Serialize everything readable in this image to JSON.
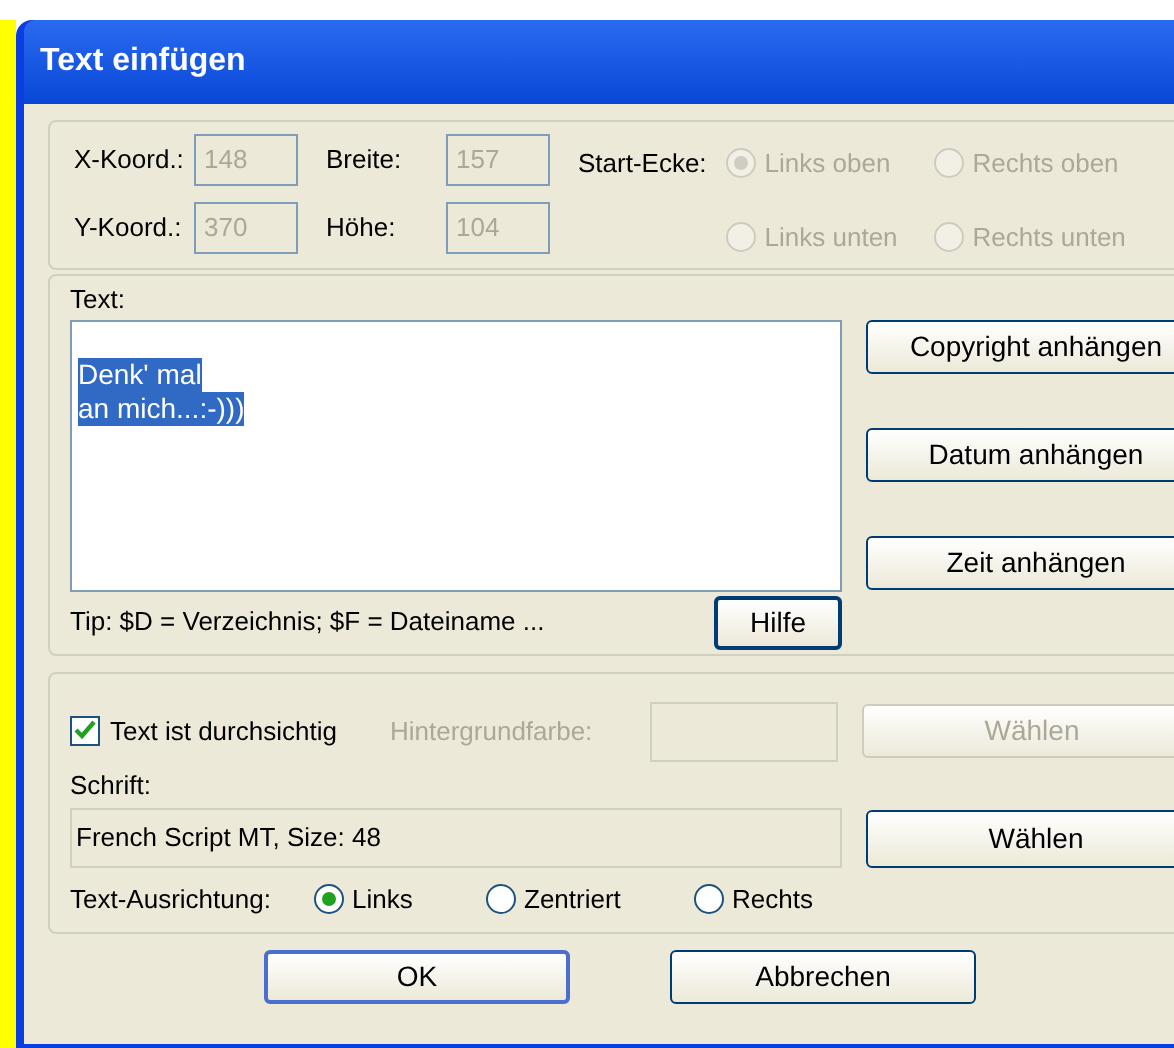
{
  "window": {
    "title": "Text einfügen"
  },
  "position": {
    "x": {
      "label": "X-Koord.:",
      "value": "148",
      "disabled": true
    },
    "y": {
      "label": "Y-Koord.:",
      "value": "370",
      "disabled": true
    },
    "width": {
      "label": "Breite:",
      "value": "157",
      "disabled": true
    },
    "height": {
      "label": "Höhe:",
      "value": "104",
      "disabled": true
    }
  },
  "start_corner": {
    "label": "Start-Ecke:",
    "options": [
      {
        "label": "Links oben",
        "selected": true,
        "disabled": true
      },
      {
        "label": "Rechts oben",
        "selected": false,
        "disabled": true
      },
      {
        "label": "Links unten",
        "selected": false,
        "disabled": true
      },
      {
        "label": "Rechts unten",
        "selected": false,
        "disabled": true
      }
    ]
  },
  "text": {
    "label": "Text:",
    "lines": [
      "Denk' mal",
      "an mich...:-)))"
    ],
    "selected": true
  },
  "append_buttons": [
    "Copyright anhängen",
    "Datum anhängen",
    "Zeit anhängen"
  ],
  "tip": "Tip: $D = Verzeichnis; $F = Dateiname ...",
  "help_button": "Hilfe",
  "transparent": {
    "label": "Text ist durchsichtig",
    "checked": true
  },
  "background": {
    "label": "Hintergrundfarbe:",
    "button": "Wählen",
    "disabled": true
  },
  "font": {
    "label": "Schrift:",
    "value": "French Script MT, Size: 48",
    "button": "Wählen"
  },
  "alignment": {
    "label": "Text-Ausrichtung:",
    "options": [
      {
        "label": "Links",
        "selected": true
      },
      {
        "label": "Zentriert",
        "selected": false
      },
      {
        "label": "Rechts",
        "selected": false
      }
    ]
  },
  "buttons": [
    "OK",
    "Abbrechen"
  ]
}
